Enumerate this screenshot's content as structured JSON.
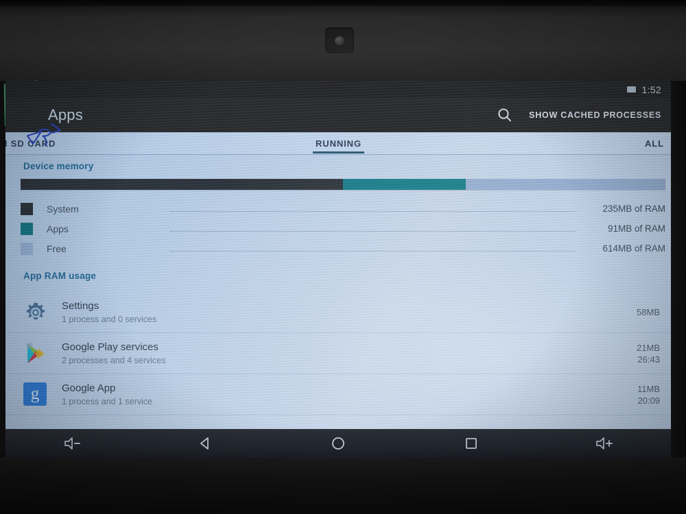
{
  "device": {
    "camera_label": "front-camera",
    "tape_label": "green-tape-patch"
  },
  "status_bar": {
    "battery_icon": "battery-icon",
    "time": "1:52"
  },
  "action_bar": {
    "title": "Apps",
    "search_icon": "search-icon",
    "cached_button": "SHOW CACHED PROCESSES"
  },
  "tabs": [
    {
      "label": "ON SD CARD",
      "active": false
    },
    {
      "label": "RUNNING",
      "active": true
    },
    {
      "label": "ALL",
      "active": false
    }
  ],
  "device_memory": {
    "header": "Device memory",
    "bar": {
      "system_pct": 50.0,
      "apps_pct": 19.0,
      "free_pct": 31.0
    },
    "legend": [
      {
        "label": "System",
        "value": "235MB of RAM",
        "color": "#262b30"
      },
      {
        "label": "Apps",
        "value": "91MB of RAM",
        "color": "#0d7a84"
      },
      {
        "label": "Free",
        "value": "614MB of RAM",
        "color": "#a8bcd8"
      }
    ]
  },
  "app_ram_usage": {
    "header": "App RAM usage",
    "apps": [
      {
        "icon": "settings-gear-icon",
        "name": "Settings",
        "subtitle": "1 process and 0 services",
        "size": "58MB",
        "duration": ""
      },
      {
        "icon": "google-play-services-icon",
        "name": "Google Play services",
        "subtitle": "2 processes and 4 services",
        "size": "21MB",
        "duration": "26:43"
      },
      {
        "icon": "google-app-icon",
        "name": "Google App",
        "subtitle": "1 process and 1 service",
        "size": "11MB",
        "duration": "20:09"
      }
    ]
  },
  "nav_bar": {
    "buttons": [
      {
        "icon": "volume-down-icon"
      },
      {
        "icon": "back-icon"
      },
      {
        "icon": "home-icon"
      },
      {
        "icon": "recents-icon"
      },
      {
        "icon": "volume-up-icon"
      }
    ]
  },
  "annotations": {
    "pen_mark": "blue-pen-scribble"
  },
  "colors": {
    "accent": "#1a6a92",
    "system": "#262b30",
    "apps": "#0d7a84",
    "free": "#a8bcd8",
    "actionbar": "#222222"
  }
}
